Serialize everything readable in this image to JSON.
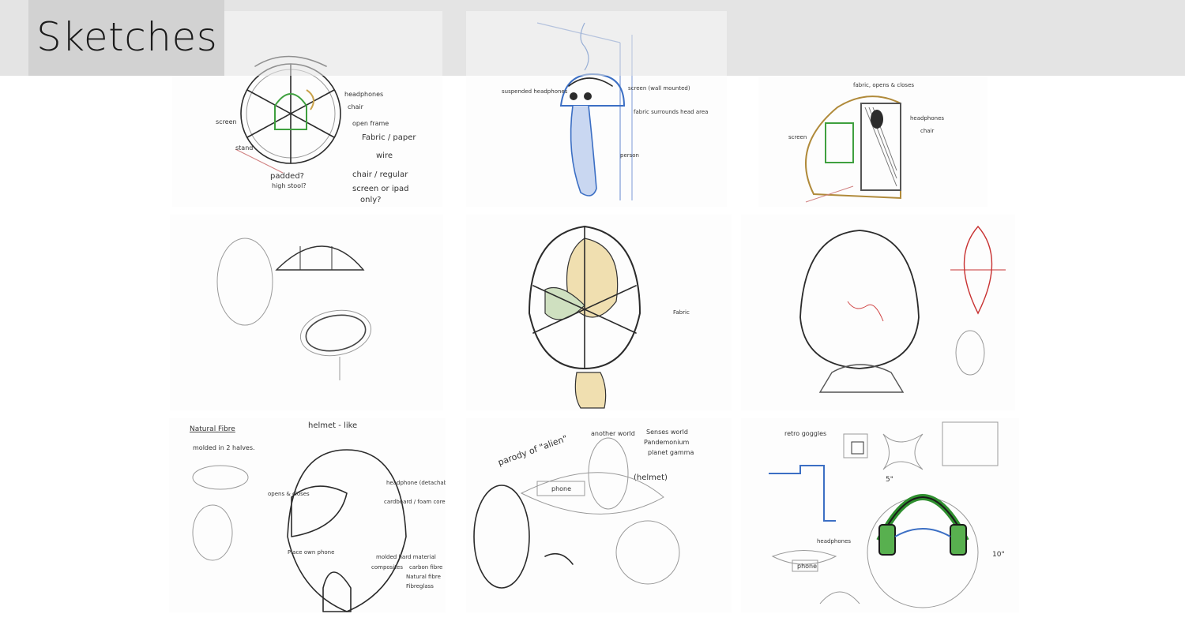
{
  "page": {
    "title": "Sketches"
  },
  "colors": {
    "header_band": "#e4e4e4",
    "title_box": "#d2d2d2",
    "ink": "#2b2b2b",
    "blue_pencil": "#3c6fc4",
    "green_pencil": "#3fa03f",
    "red_pencil": "#c83232",
    "yellow_pencil": "#e0c070"
  },
  "sketches": {
    "s1": {
      "labels": [
        "headphones",
        "chair",
        "screen",
        "stand",
        "open frame",
        "Fabric / paper",
        "wire",
        "padded?",
        "high stool?",
        "chair / regular",
        "screen or ipad",
        "only?"
      ]
    },
    "s2": {
      "labels": [
        "suspended headphones",
        "screen (wall mounted)",
        "fabric surrounds head area",
        "person"
      ]
    },
    "s3": {
      "labels": [
        "fabric, opens & closes",
        "headphones",
        "screen",
        "chair"
      ]
    },
    "s5": {
      "labels": [
        "Fabric"
      ]
    },
    "s7": {
      "labels": [
        "Natural Fibre",
        "molded in 2 halves.",
        "helmet - like",
        "opens & closes",
        "headphone (detachable)",
        "cardboard / foam core",
        "Place own phone",
        "molded hard material",
        "composites",
        "carbon fibre",
        "Natural fibre",
        "Fibreglass"
      ]
    },
    "s8": {
      "labels": [
        "parody of \"alien\"",
        "another world",
        "Senses world",
        "Pandemonium",
        "planet gamma",
        "(helmet)",
        "phone"
      ]
    },
    "s9": {
      "labels": [
        "retro goggles",
        "5\"",
        "10\"",
        "phone",
        "headphones"
      ]
    }
  }
}
